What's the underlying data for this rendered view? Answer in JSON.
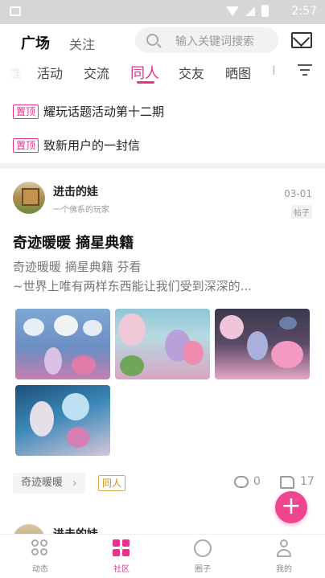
{
  "status_bar": {
    "time": "2:57"
  },
  "header": {
    "tabs": [
      {
        "label": "广场",
        "active": true
      },
      {
        "label": "关注",
        "active": false
      }
    ],
    "search_placeholder": "输入关键词搜索"
  },
  "categories": {
    "items": [
      "推",
      "活动",
      "交流",
      "同人",
      "交友",
      "晒图",
      "I"
    ],
    "active": "同人"
  },
  "pinned": [
    {
      "badge": "置顶",
      "title": "耀玩话题活动第十二期"
    },
    {
      "badge": "置顶",
      "title": "致新用户的一封信"
    }
  ],
  "post": {
    "author": "进击的娃",
    "author_subtitle": "一个佛系的玩家",
    "date": "03-01",
    "type": "帖子",
    "title": "奇迹暖暖 摘星典籍",
    "body": "奇迹暖暖 摘星典籍 芬看\n~世界上唯有两样东西能让我们受到深深的...",
    "topic_tag": "奇迹暖暖",
    "category_tag": "同人",
    "comments": "0",
    "likes": "17",
    "image_count": 4
  },
  "next_post": {
    "author": "进击的娃"
  },
  "fab": {
    "label": "+"
  },
  "bottom_nav": [
    {
      "label": "动态",
      "icon": "feed-icon",
      "active": false
    },
    {
      "label": "社区",
      "icon": "community-icon",
      "active": true
    },
    {
      "label": "圈子",
      "icon": "circle-icon",
      "active": false
    },
    {
      "label": "我的",
      "icon": "profile-icon",
      "active": false
    }
  ],
  "colors": {
    "accent": "#e8318c",
    "fab": "#f0458f",
    "tag_orange": "#d28a1a"
  }
}
